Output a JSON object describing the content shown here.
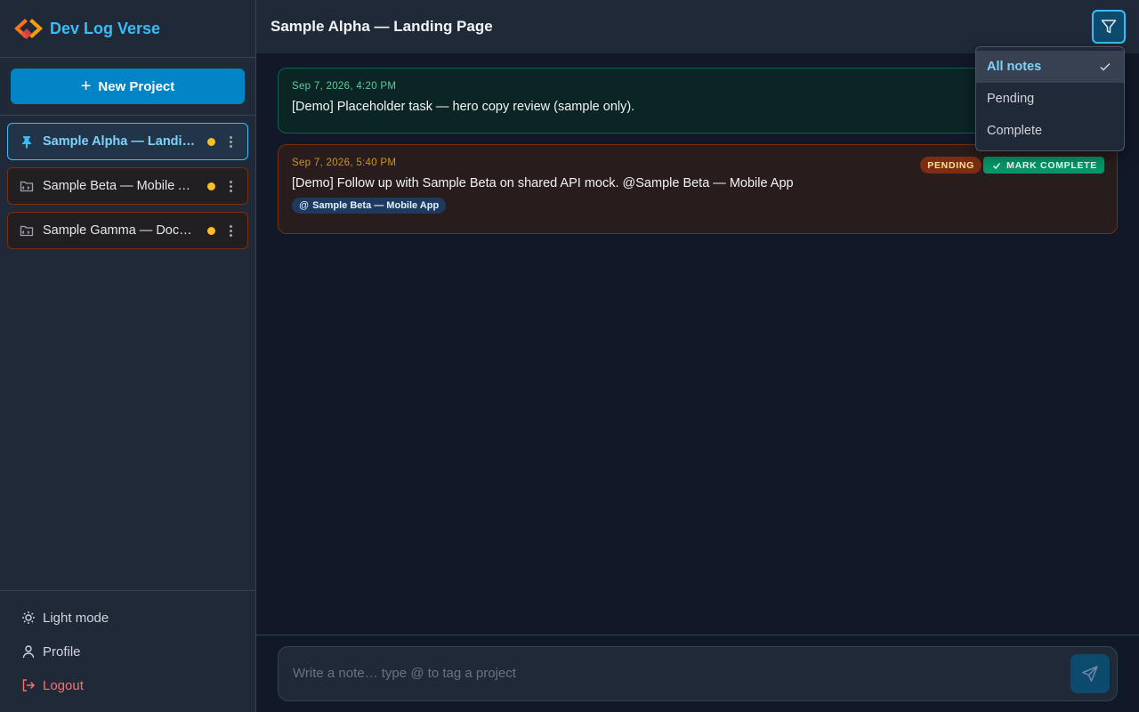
{
  "app": {
    "name": "Dev Log Verse"
  },
  "sidebar": {
    "new_project_label": "New Project",
    "projects": [
      {
        "label": "Sample Alpha — Landing Page",
        "active": true,
        "pinned": true
      },
      {
        "label": "Sample Beta — Mobile App",
        "active": false,
        "pinned": false
      },
      {
        "label": "Sample Gamma — Docs Site",
        "active": false,
        "pinned": false
      }
    ],
    "footer": {
      "light_mode": "Light mode",
      "profile": "Profile",
      "logout": "Logout"
    }
  },
  "header": {
    "title": "Sample Alpha — Landing Page"
  },
  "filter_menu": {
    "options": [
      "All notes",
      "Pending",
      "Complete"
    ],
    "selected": "All notes"
  },
  "notes": [
    {
      "timestamp": "Sep 7, 2026, 4:20 PM",
      "text": "[Demo] Placeholder task — hero copy review (sample only).",
      "status": "complete"
    },
    {
      "timestamp": "Sep 7, 2026, 5:40 PM",
      "text": "[Demo] Follow up with Sample Beta on shared API mock. @Sample Beta — Mobile App",
      "status": "pending",
      "status_label": "PENDING",
      "action_label": "MARK COMPLETE",
      "tag": "Sample Beta — Mobile App"
    }
  ],
  "composer": {
    "placeholder": "Write a note… type @ to tag a project"
  },
  "colors": {
    "accent": "#38bdf8",
    "primary_button": "#0284c7",
    "pending_dot": "#fbbf24",
    "complete": "#059669",
    "logout": "#f87171"
  }
}
